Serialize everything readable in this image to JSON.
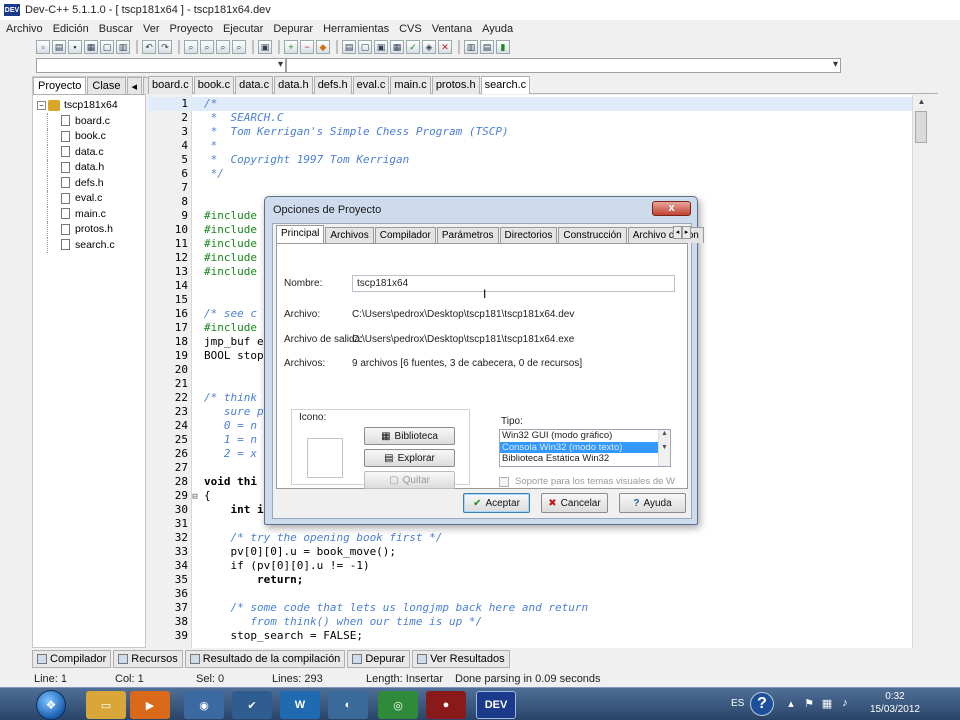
{
  "window": {
    "title": "Dev-C++ 5.1.1.0 - [ tscp181x64 ] - tscp181x64.dev",
    "app_icon": "DEV"
  },
  "menu": [
    "Archivo",
    "Edición",
    "Buscar",
    "Ver",
    "Proyecto",
    "Ejecutar",
    "Depurar",
    "Herramientas",
    "CVS",
    "Ventana",
    "Ayuda"
  ],
  "project_panel": {
    "tabs": [
      "Proyecto",
      "Clase"
    ],
    "root": "tscp181x64",
    "files": [
      "board.c",
      "book.c",
      "data.c",
      "data.h",
      "defs.h",
      "eval.c",
      "main.c",
      "protos.h",
      "search.c"
    ]
  },
  "file_tabs": [
    "board.c",
    "book.c",
    "data.c",
    "data.h",
    "defs.h",
    "eval.c",
    "main.c",
    "protos.h",
    "search.c"
  ],
  "editor": {
    "lines": [
      {
        "n": "1",
        "code": "/*",
        "cls": "c-comment",
        "hl": true
      },
      {
        "n": "2",
        "code": " *  SEARCH.C",
        "cls": "c-comment"
      },
      {
        "n": "3",
        "code": " *  Tom Kerrigan's Simple Chess Program (TSCP)",
        "cls": "c-comment"
      },
      {
        "n": "4",
        "code": " *",
        "cls": "c-comment"
      },
      {
        "n": "5",
        "code": " *  Copyright 1997 Tom Kerrigan",
        "cls": "c-comment"
      },
      {
        "n": "6",
        "code": " */",
        "cls": "c-comment"
      },
      {
        "n": "7",
        "code": ""
      },
      {
        "n": "8",
        "code": ""
      },
      {
        "n": "9",
        "code": "#include",
        "cls": "c-dir"
      },
      {
        "n": "10",
        "code": "#include",
        "cls": "c-dir"
      },
      {
        "n": "11",
        "code": "#include",
        "cls": "c-dir"
      },
      {
        "n": "12",
        "code": "#include",
        "cls": "c-dir"
      },
      {
        "n": "13",
        "code": "#include",
        "cls": "c-dir"
      },
      {
        "n": "14",
        "code": ""
      },
      {
        "n": "15",
        "code": ""
      },
      {
        "n": "16",
        "code": "/* see c",
        "cls": "c-comment"
      },
      {
        "n": "17",
        "code": "#include",
        "cls": "c-dir"
      },
      {
        "n": "18",
        "code": "jmp_buf e"
      },
      {
        "n": "19",
        "code": "BOOL stop"
      },
      {
        "n": "20",
        "code": ""
      },
      {
        "n": "21",
        "code": ""
      },
      {
        "n": "22",
        "code": "/* think",
        "cls": "c-comment"
      },
      {
        "n": "23",
        "code": "   sure p",
        "cls": "c-comment"
      },
      {
        "n": "24",
        "code": "   0 = n",
        "cls": "c-comment"
      },
      {
        "n": "25",
        "code": "   1 = n",
        "cls": "c-comment"
      },
      {
        "n": "26",
        "code": "   2 = x",
        "cls": "c-comment"
      },
      {
        "n": "27",
        "code": ""
      },
      {
        "n": "28",
        "code": "void thi",
        "cls": "c-kw"
      },
      {
        "n": "29",
        "code": "{",
        "fold": "⊟"
      },
      {
        "n": "30",
        "code": "    int i",
        "cls": "c-kw"
      },
      {
        "n": "31",
        "code": ""
      },
      {
        "n": "32",
        "code": "    /* try the opening book first */",
        "cls": "c-comment"
      },
      {
        "n": "33",
        "code": "    pv[0][0].u = book_move();"
      },
      {
        "n": "34",
        "code": "    if (pv[0][0].u != -1)"
      },
      {
        "n": "35",
        "code": "        return;",
        "cls": "c-kw"
      },
      {
        "n": "36",
        "code": ""
      },
      {
        "n": "37",
        "code": "    /* some code that lets us longjmp back here and return",
        "cls": "c-comment"
      },
      {
        "n": "38",
        "code": "       from think() when our time is up */",
        "cls": "c-comment"
      },
      {
        "n": "39",
        "code": "    stop_search = FALSE;"
      }
    ]
  },
  "bottom_tabs": [
    "Compilador",
    "Recursos",
    "Resultado de la compilación",
    "Depurar",
    "Ver Resultados"
  ],
  "status": {
    "line": "Line:  1",
    "col": "Col:  1",
    "sel": "Sel:  0",
    "lines": "Lines:  293",
    "length": "Length: Insertar",
    "message": "Done parsing in 0.09 seconds"
  },
  "dialog": {
    "title": "Opciones de Proyecto",
    "close": "x",
    "tabs": [
      "Principal",
      "Archivos",
      "Compilador",
      "Parámetros",
      "Directorios",
      "Construcción",
      "Archivo de con"
    ],
    "nombre_label": "Nombre:",
    "nombre_value": "tscp181x64",
    "archivo_label": "Archivo:",
    "archivo_value": "C:\\Users\\pedrox\\Desktop\\tscp181\\tscp181x64.dev",
    "salida_label": "Archivo de salida:",
    "salida_value": "C:\\Users\\pedrox\\Desktop\\tscp181\\tscp181x64.exe",
    "archivos_label": "Archivos:",
    "archivos_value": "9 archivos [6 fuentes, 3 de cabecera, 0 de recursos]",
    "icono_label": "Icono:",
    "btn_biblioteca": "Biblioteca",
    "btn_explorar": "Explorar",
    "btn_quitar": "Quitar",
    "tipo_label": "Tipo:",
    "tipo_options": [
      "Win32 GUI (modo gráfico)",
      "Consola Win32 (modo texto)",
      "Biblioteca Estática Win32"
    ],
    "tipo_selected": 1,
    "checkbox_label": "Soporte para los temas visuales de W",
    "btn_aceptar": "Aceptar",
    "btn_cancelar": "Cancelar",
    "btn_ayuda": "Ayuda"
  },
  "taskbar": {
    "lang": "ES",
    "time": "0:32",
    "date": "15/03/2012",
    "dev_label": "DEV"
  }
}
